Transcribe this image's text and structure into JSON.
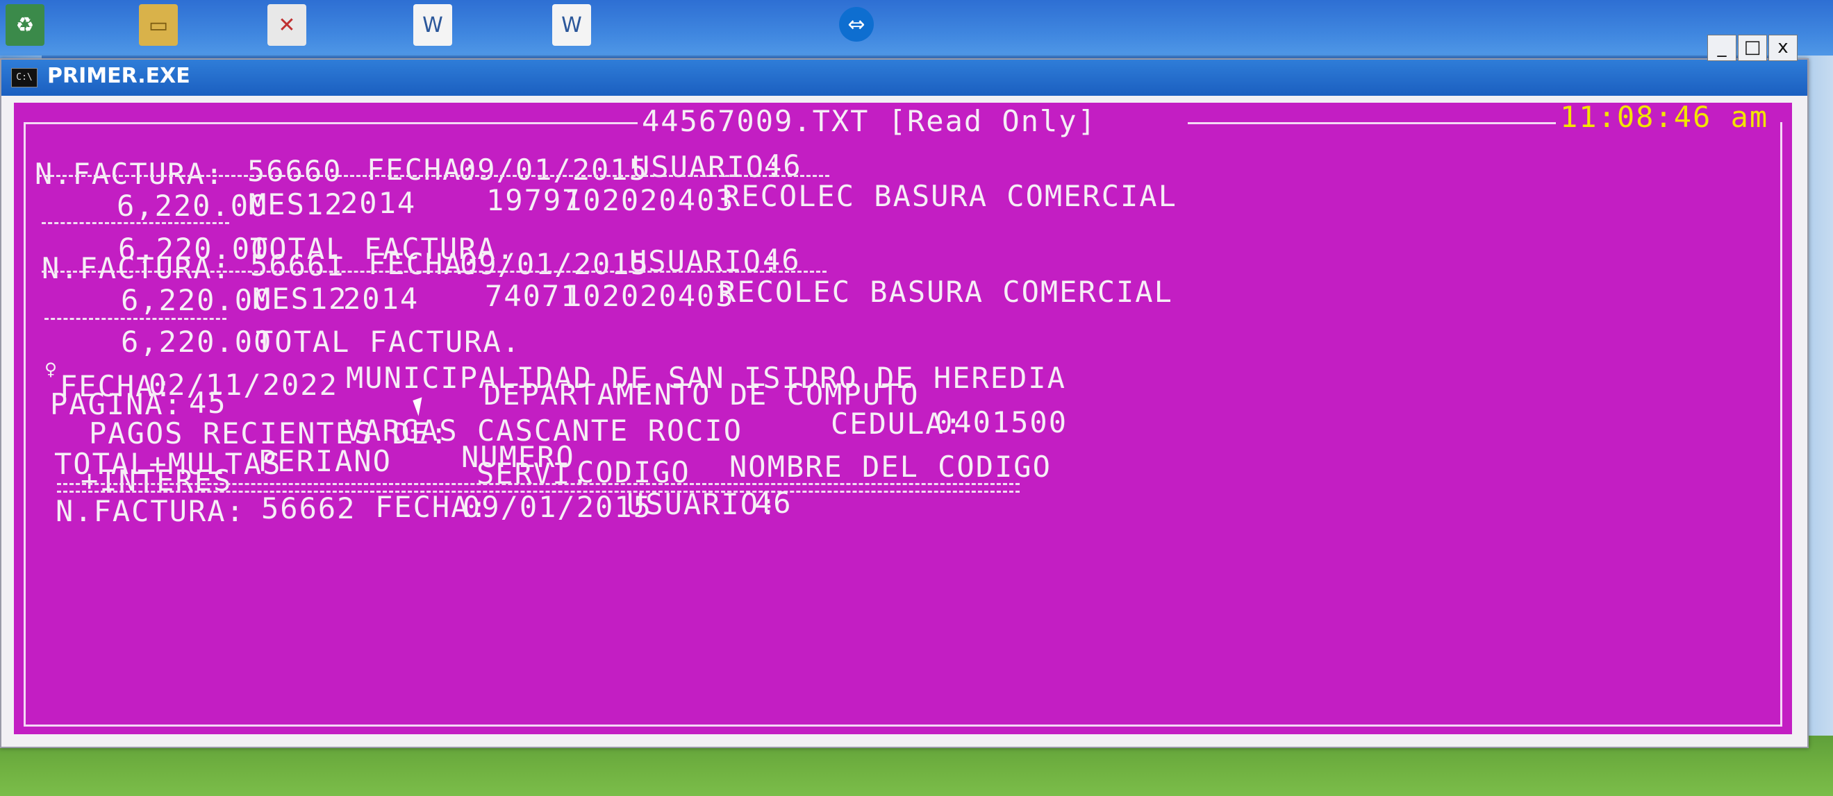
{
  "window": {
    "title": "PRIMER.EXE",
    "app_icon_text": "C:\\",
    "minimize": "_",
    "maximize": "□",
    "close": "x"
  },
  "console": {
    "file_header": "44567009.TXT [Read Only]",
    "clock": "11:08:46 am",
    "invoices": [
      {
        "label": "N.FACTURA:",
        "number": "56660",
        "fecha_label": "FECHA:",
        "fecha": "09/01/2015",
        "usuario_label": "USUARIO:",
        "usuario": "46",
        "amount": "6,220.00",
        "mes": "MES12",
        "year": "2014",
        "servicio": "19797",
        "codigo": "102020403",
        "descripcion": "RECOLEC BASURA COMERCIAL",
        "total": "6,220.00",
        "total_label": "TOTAL FACTURA."
      },
      {
        "label": "N.FACTURA:",
        "number": "56661",
        "fecha_label": "FECHA:",
        "fecha": "09/01/2015",
        "usuario_label": "USUARIO:",
        "usuario": "46",
        "amount": "6,220.00",
        "mes": "MES12",
        "year": "2014",
        "servicio": "74071",
        "codigo": "102020403",
        "descripcion": "RECOLEC BASURA COMERCIAL",
        "total": "6,220.00",
        "total_label": "TOTAL FACTURA."
      }
    ],
    "page_header": {
      "form_feed": "♀",
      "fecha_label": "FECHA:",
      "fecha": "02/11/2022",
      "municipality": "MUNICIPALIDAD DE SAN ISIDRO DE HEREDIA",
      "pagina_label": "PAGINA:",
      "pagina": "45",
      "department": "DEPARTAMENTO DE COMPUTO",
      "pagos_label": "PAGOS RECIENTES DE:",
      "person": "VARGAS CASCANTE ROCIO",
      "cedula_label": "CEDULA:",
      "cedula": "0401500"
    },
    "columns": {
      "total_multas": "TOTAL+MULTAS",
      "intereses": "+INTERES",
      "peri": "PERI",
      "ano": "ANO",
      "numero": "NUMERO",
      "servi": "SERVI.",
      "codigo": "CODIGO",
      "nombre": "NOMBRE DEL CODIGO"
    },
    "last_invoice": {
      "label": "N.FACTURA:",
      "number": "56662",
      "fecha_label": "FECHA:",
      "fecha": "09/01/2015",
      "usuario_label": "USUARIO:",
      "usuario": "46"
    }
  },
  "colors": {
    "console_bg": "#c31ec3",
    "console_text": "#f6eef6",
    "clock_text": "#f3e400",
    "titlebar": "#1b5fc0"
  }
}
